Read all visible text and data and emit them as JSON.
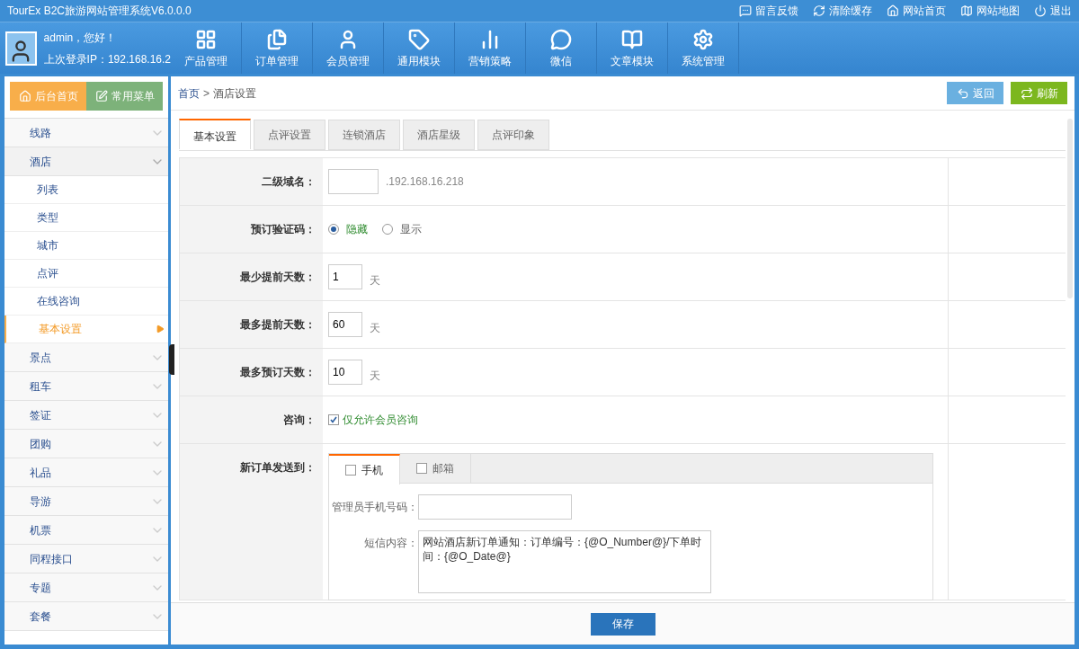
{
  "window": {
    "title": "TourEx B2C旅游网站管理系统V6.0.0.0"
  },
  "top_links": [
    "留言反馈",
    "清除缓存",
    "网站首页",
    "网站地图",
    "退出"
  ],
  "user": {
    "greeting": "admin，您好！",
    "last_login": "上次登录IP：192.168.16.2"
  },
  "nav": [
    "产品管理",
    "订单管理",
    "会员管理",
    "通用模块",
    "营销策略",
    "微信",
    "文章模块",
    "系统管理"
  ],
  "sidebar": {
    "buttons": [
      "后台首页",
      "常用菜单"
    ],
    "items": [
      {
        "label": "线路",
        "expanded": false
      },
      {
        "label": "酒店",
        "expanded": true,
        "children": [
          {
            "label": "列表",
            "selected": false
          },
          {
            "label": "类型",
            "selected": false
          },
          {
            "label": "城市",
            "selected": false
          },
          {
            "label": "点评",
            "selected": false
          },
          {
            "label": "在线咨询",
            "selected": false
          },
          {
            "label": "基本设置",
            "selected": true
          }
        ]
      },
      {
        "label": "景点",
        "expanded": false
      },
      {
        "label": "租车",
        "expanded": false
      },
      {
        "label": "签证",
        "expanded": false
      },
      {
        "label": "团购",
        "expanded": false
      },
      {
        "label": "礼品",
        "expanded": false
      },
      {
        "label": "导游",
        "expanded": false
      },
      {
        "label": "机票",
        "expanded": false
      },
      {
        "label": "同程接口",
        "expanded": false
      },
      {
        "label": "专题",
        "expanded": false
      },
      {
        "label": "套餐",
        "expanded": false
      }
    ]
  },
  "breadcrumb": [
    "首页",
    ">",
    "酒店设置"
  ],
  "actions": [
    "返回",
    "刷新"
  ],
  "tabs": [
    {
      "label": "基本设置",
      "selected": true
    },
    {
      "label": "点评设置",
      "selected": false
    },
    {
      "label": "连锁酒店",
      "selected": false
    },
    {
      "label": "酒店星级",
      "selected": false
    },
    {
      "label": "点评印象",
      "selected": false
    }
  ],
  "form": [
    {
      "kind": "domain",
      "label": "二级域名：",
      "suffix": ".192.168.16.218"
    },
    {
      "kind": "radio",
      "label": "预订验证码：",
      "options": [
        {
          "label": "隐藏",
          "selected": true
        },
        {
          "label": "显示",
          "selected": false
        }
      ]
    },
    {
      "kind": "days",
      "label": "最少提前天数：",
      "value": "1",
      "unit": "天"
    },
    {
      "kind": "days",
      "label": "最多提前天数：",
      "value": "60",
      "unit": "天"
    },
    {
      "kind": "days",
      "label": "最多预订天数：",
      "value": "10",
      "unit": "天"
    },
    {
      "kind": "checkbox",
      "label": "咨询：",
      "text": "仅允许会员咨询",
      "checked": true
    },
    {
      "kind": "send",
      "label": "新订单发送到：",
      "tabs": [
        {
          "label": "手机",
          "checked": false,
          "selected": true
        },
        {
          "label": "邮箱",
          "checked": false,
          "selected": false
        }
      ],
      "phone_label": "管理员手机号码：",
      "sms_label": "短信内容：",
      "sms": "网站酒店新订单通知：订单编号：{@O_Number@}/下单时间：{@O_Date@}"
    }
  ],
  "save": "保存"
}
